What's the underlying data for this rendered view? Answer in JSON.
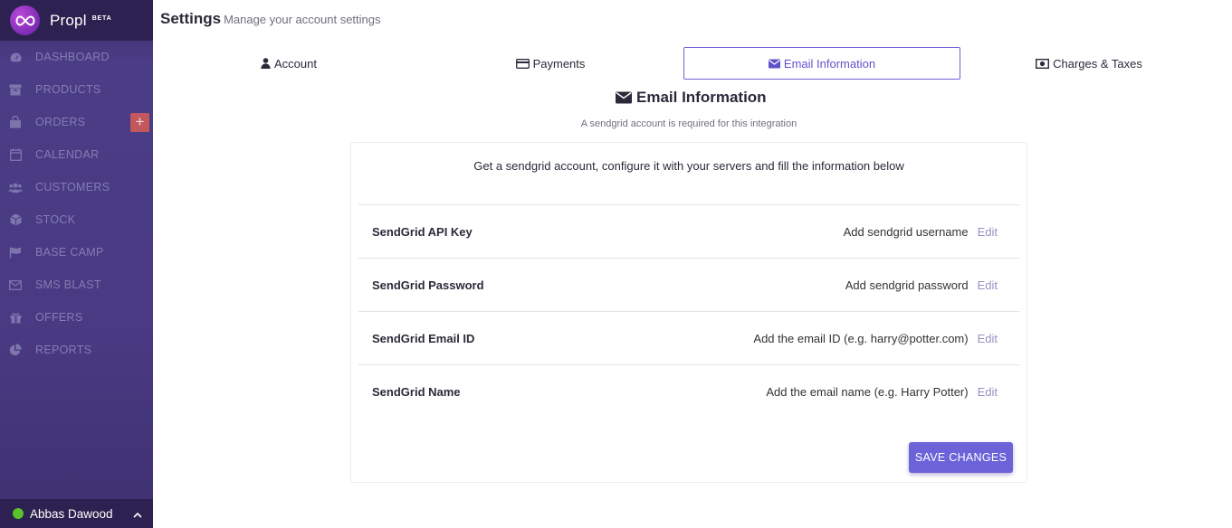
{
  "brand": {
    "name": "Propl",
    "badge": "BETA"
  },
  "sidebar": {
    "items": [
      {
        "label": "DASHBOARD",
        "icon": "dashboard-icon"
      },
      {
        "label": "PRODUCTS",
        "icon": "archive-icon"
      },
      {
        "label": "ORDERS",
        "icon": "shopping-bag-icon",
        "action": "+"
      },
      {
        "label": "CALENDAR",
        "icon": "calendar-icon"
      },
      {
        "label": "CUSTOMERS",
        "icon": "users-icon"
      },
      {
        "label": "STOCK",
        "icon": "cube-icon"
      },
      {
        "label": "BASE CAMP",
        "icon": "flag-icon"
      },
      {
        "label": "SMS BLAST",
        "icon": "envelope-icon"
      },
      {
        "label": "OFFERS",
        "icon": "gift-icon"
      },
      {
        "label": "REPORTS",
        "icon": "pie-chart-icon"
      }
    ]
  },
  "user": {
    "name": "Abbas Dawood",
    "status_color": "#5ac32c"
  },
  "header": {
    "title": "Settings",
    "subtitle": "Manage your account settings"
  },
  "tabs": [
    {
      "label": "Account",
      "icon": "user-icon"
    },
    {
      "label": "Payments",
      "icon": "credit-card-icon"
    },
    {
      "label": "Email Information",
      "icon": "envelope-icon",
      "active": true
    },
    {
      "label": "Charges & Taxes",
      "icon": "money-bill-icon"
    }
  ],
  "section": {
    "title": "Email Information",
    "subtitle": "A sendgrid account is required for this integration",
    "intro": "Get a sendgrid account, configure it with your servers and fill the information below",
    "rows": [
      {
        "label": "SendGrid API Key",
        "value": "Add sendgrid username",
        "edit": "Edit"
      },
      {
        "label": "SendGrid Password",
        "value": "Add sendgrid password",
        "edit": "Edit"
      },
      {
        "label": "SendGrid Email ID",
        "value": "Add the email ID (e.g. harry@potter.com)",
        "edit": "Edit"
      },
      {
        "label": "SendGrid Name",
        "value": "Add the email name (e.g. Harry Potter)",
        "edit": "Edit"
      }
    ],
    "save_label": "SAVE CHANGES"
  },
  "colors": {
    "accent": "#6c63d9",
    "sidebar": "#4b3c86",
    "sidebar_dark": "#2c2150",
    "orders_add": "#c2585e"
  }
}
